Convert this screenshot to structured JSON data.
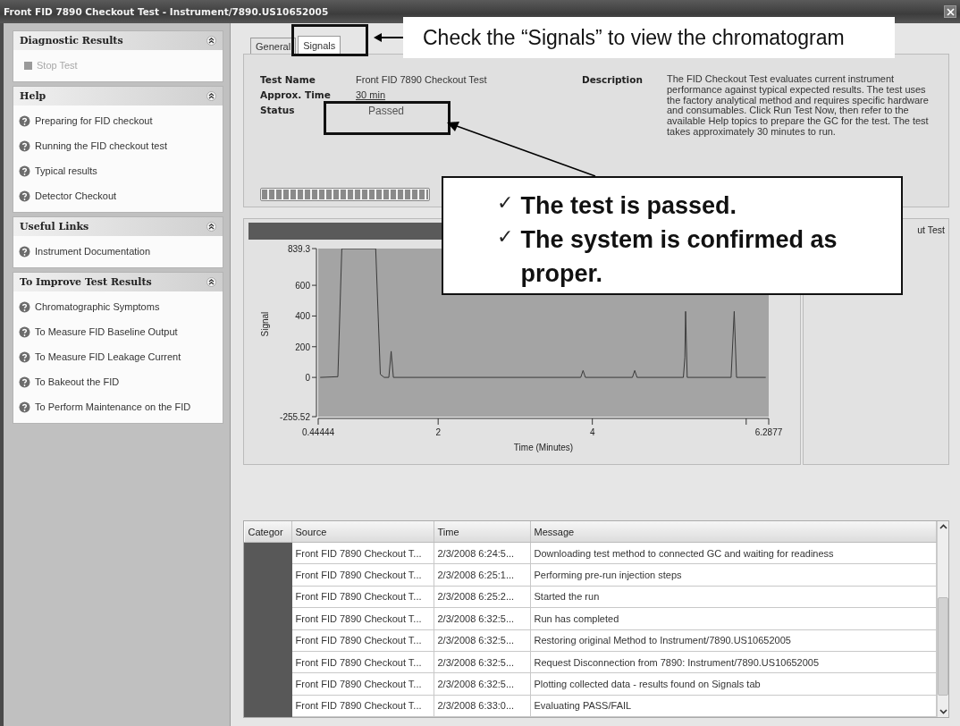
{
  "window": {
    "title": "Front FID 7890 Checkout Test - Instrument/7890.US10652005"
  },
  "sidebar": {
    "sections": [
      {
        "title": "Diagnostic Results",
        "expanded": true,
        "items": [
          {
            "label": "Stop Test",
            "kind": "command",
            "disabled": true
          }
        ]
      },
      {
        "title": "Help",
        "expanded": true,
        "items": [
          {
            "label": "Preparing for FID checkout",
            "kind": "help",
            "disabled": false
          },
          {
            "label": "Running the FID checkout test",
            "kind": "help",
            "disabled": false
          },
          {
            "label": "Typical results",
            "kind": "help",
            "disabled": false
          },
          {
            "label": "Detector Checkout",
            "kind": "help",
            "disabled": false
          }
        ]
      },
      {
        "title": "Useful Links",
        "expanded": true,
        "items": [
          {
            "label": "Instrument Documentation",
            "kind": "help",
            "disabled": false
          }
        ]
      },
      {
        "title": "To Improve Test Results",
        "expanded": true,
        "items": [
          {
            "label": "Chromatographic Symptoms",
            "kind": "help",
            "disabled": false
          },
          {
            "label": "To Measure FID Baseline Output",
            "kind": "help",
            "disabled": false
          },
          {
            "label": "To Measure FID Leakage Current",
            "kind": "help",
            "disabled": false
          },
          {
            "label": "To Bakeout the FID",
            "kind": "help",
            "disabled": false
          },
          {
            "label": "To Perform Maintenance on the FID",
            "kind": "help",
            "disabled": false
          }
        ]
      }
    ]
  },
  "tabs": [
    {
      "label": "General",
      "selected": false
    },
    {
      "label": "Signals",
      "selected": true
    }
  ],
  "test_info": {
    "fields": [
      {
        "label": "Test Name",
        "value": "Front FID 7890 Checkout Test"
      },
      {
        "label": "Approx. Time",
        "value": "30 min"
      },
      {
        "label": "Status",
        "value": "Passed"
      }
    ],
    "description_label": "Description",
    "description": "The FID Checkout Test evaluates current instrument performance against typical expected results. The test uses the factory analytical method and requires specific hardware and consumables. Click Run Test Now, then refer to the available Help topics to prepare the GC for the test. The test takes approximately 30 minutes to run.",
    "progress": {
      "level": 1
    }
  },
  "chromatogram": {
    "legend": "ut Test",
    "chart_data": {
      "type": "line",
      "xlabel": "Time (Minutes)",
      "ylabel": "Signal",
      "x": [
        0.47,
        0.7,
        0.75,
        1.19,
        1.25,
        1.3,
        1.36,
        1.39,
        1.42,
        3.85,
        3.88,
        3.91,
        4.52,
        4.55,
        4.58,
        5.18,
        5.2,
        5.21,
        5.23,
        5.8,
        5.84,
        5.87,
        6.25
      ],
      "series": [
        {
          "color": "#3a3a3a",
          "values": [
            0,
            5,
            839,
            839,
            20,
            0,
            0,
            170,
            0,
            0,
            45,
            0,
            0,
            45,
            0,
            0,
            130,
            430,
            0,
            0,
            430,
            0,
            0
          ]
        }
      ],
      "xlim": [
        0.44444,
        6.2877
      ],
      "ylim": [
        -255.52,
        839.3
      ],
      "xticks": [
        {
          "value": 0.44444,
          "label": "0.44444"
        },
        2,
        4,
        {
          "value": 6.2877,
          "label": "6.2877"
        }
      ],
      "yticks": [
        {
          "value": -255.52,
          "label": "-255.52"
        },
        0,
        200,
        400,
        600,
        {
          "value": 839.3,
          "label": "839.3"
        }
      ]
    }
  },
  "log_table": {
    "columns": [
      "Categor",
      "Source",
      "Time",
      "Message"
    ],
    "rows": [
      {
        "source": "Front FID 7890 Checkout T...",
        "time": "2/3/2008 6:24:5...",
        "message": "Downloading test method to connected GC and waiting for readiness"
      },
      {
        "source": "Front FID 7890 Checkout T...",
        "time": "2/3/2008 6:25:1...",
        "message": "Performing pre-run injection steps"
      },
      {
        "source": "Front FID 7890 Checkout T...",
        "time": "2/3/2008 6:25:2...",
        "message": "Started the run"
      },
      {
        "source": "Front FID 7890 Checkout T...",
        "time": "2/3/2008 6:32:5...",
        "message": "Run has completed"
      },
      {
        "source": "Front FID 7890 Checkout T...",
        "time": "2/3/2008 6:32:5...",
        "message": "Restoring original Method to Instrument/7890.US10652005"
      },
      {
        "source": "Front FID 7890 Checkout T...",
        "time": "2/3/2008 6:32:5...",
        "message": "Request Disconnection from 7890: Instrument/7890.US10652005"
      },
      {
        "source": "Front FID 7890 Checkout T...",
        "time": "2/3/2008 6:32:5...",
        "message": "Plotting collected data - results found on Signals tab"
      },
      {
        "source": "Front FID 7890 Checkout T...",
        "time": "2/3/2008 6:33:0...",
        "message": "Evaluating PASS/FAIL"
      }
    ]
  },
  "annotations": [
    {
      "kind": "note",
      "text": "Check the “Signals” to view the chromatogram"
    },
    {
      "kind": "checklist",
      "items": [
        {
          "mark": "✓",
          "text": "The test is passed."
        },
        {
          "mark": "✓",
          "text": "The system is confirmed as proper."
        }
      ]
    }
  ]
}
